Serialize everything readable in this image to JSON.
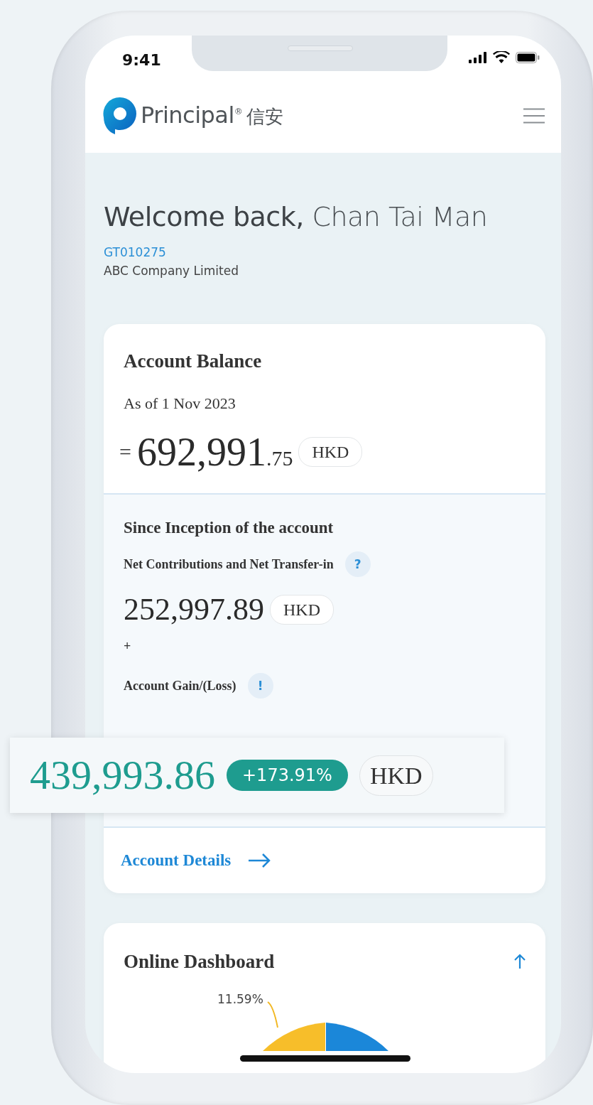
{
  "status_bar": {
    "time": "9:41"
  },
  "header": {
    "brand": "Principal",
    "brand_mark": "®",
    "brand_chinese": "信安"
  },
  "welcome": {
    "greeting": "Welcome back,",
    "name": "Chan Tai Man",
    "account_number": "GT010275",
    "company": "ABC Company Limited"
  },
  "balance_card": {
    "title": "Account Balance",
    "as_of": "As of 1 Nov 2023",
    "prefix": "=",
    "amount_whole": "692,991",
    "amount_decimal": ".75",
    "currency": "HKD",
    "since": {
      "title": "Since Inception of the account",
      "contributions_label": "Net Contributions and Net Transfer-in",
      "contributions_help": "?",
      "contributions_amount": "252,997.89",
      "contributions_currency": "HKD",
      "operator": "+",
      "gain_label": "Account Gain/(Loss)",
      "gain_help": "!"
    },
    "link": "Account Details"
  },
  "highlight": {
    "amount": "439,993.86",
    "change": "+173.91%",
    "currency": "HKD"
  },
  "dashboard": {
    "title": "Online Dashboard",
    "slice_label": "11.59%"
  }
}
